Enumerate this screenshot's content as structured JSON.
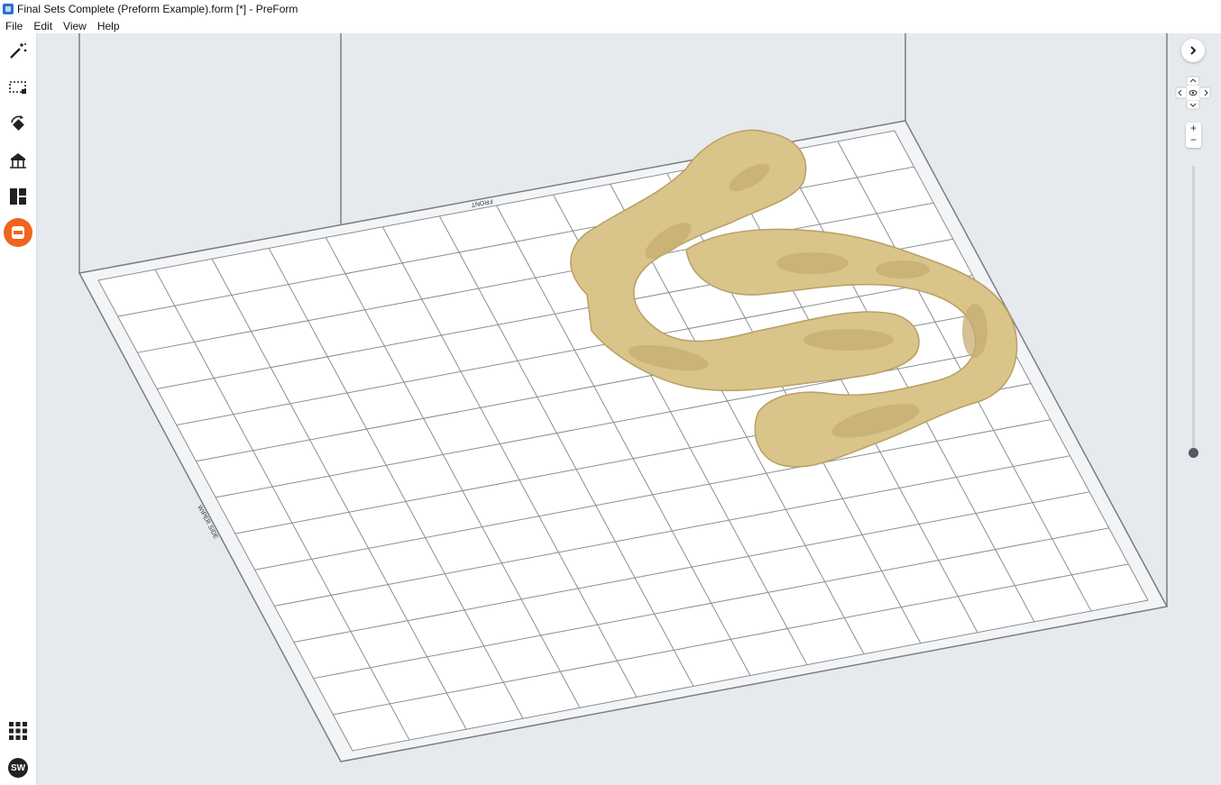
{
  "window": {
    "title": "Final Sets Complete (Preform Example).form [*] - PreForm"
  },
  "menu": [
    "File",
    "Edit",
    "View",
    "Help"
  ],
  "toolbar": {
    "tools": [
      {
        "name": "one-click-print-icon"
      },
      {
        "name": "select-icon"
      },
      {
        "name": "orient-icon"
      },
      {
        "name": "supports-icon"
      },
      {
        "name": "layout-icon"
      },
      {
        "name": "active-tool-icon"
      }
    ],
    "bottom": [
      {
        "name": "apps-grid-icon"
      },
      {
        "name": "account-avatar",
        "label": "SW"
      }
    ],
    "accent_color": "#f0641e"
  },
  "build_plate": {
    "front_label": "FRONT",
    "side_label": "WIPER SIDE"
  },
  "nav": {
    "expand_icon": "chevron-right-icon",
    "zoom_in": "+",
    "zoom_out": "−",
    "layer_slider_value": 0
  },
  "colors": {
    "model": "#d9c48a",
    "viewport_bg": "#e6e9ed",
    "plate": "#ffffff",
    "grid": "#8a8e94"
  }
}
